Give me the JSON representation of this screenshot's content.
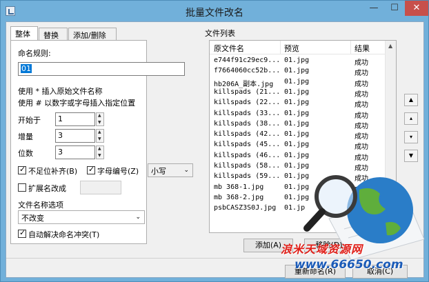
{
  "window": {
    "title": "批量文件改名",
    "minimize_glyph": "—",
    "maximize_glyph": "☐",
    "close_glyph": "✕"
  },
  "tabs": [
    {
      "label": "整体"
    },
    {
      "label": "替换"
    },
    {
      "label": "添加/删除"
    }
  ],
  "rules": {
    "label": "命名规则:",
    "value": "01",
    "hint1": "使用 * 插入原始文件名称",
    "hint2": "使用 # 以数字或字母插入指定位置",
    "start_label": "开始于",
    "start_value": "1",
    "step_label": "增量",
    "step_value": "3",
    "digits_label": "位数",
    "digits_value": "3",
    "pad_label": "不足位补齐(B)",
    "letter_label": "字母编号(Z)",
    "case_value": "小写",
    "ext_label": "扩展名改成",
    "options_label": "文件名称选项",
    "options_value": "不改变",
    "conflict_label": "自动解决命名冲突(T)"
  },
  "filelist": {
    "title": "文件列表",
    "headers": [
      "原文件名",
      "预览",
      "结果"
    ],
    "rows": [
      {
        "name": "e744f91c29ec9...",
        "preview": "01.jpg",
        "result": "成功"
      },
      {
        "name": "f7664060cc52b...",
        "preview": "01.jpg",
        "result": "成功"
      },
      {
        "name": "hb206A_副本.jpg",
        "preview": "01.jpg",
        "result": "成功"
      },
      {
        "name": "killspads (21...",
        "preview": "01.jpg",
        "result": "成功"
      },
      {
        "name": "killspads (22...",
        "preview": "01.jpg",
        "result": "成功"
      },
      {
        "name": "killspads (33...",
        "preview": "01.jpg",
        "result": "成功"
      },
      {
        "name": "killspads (38...",
        "preview": "01.jpg",
        "result": "成功"
      },
      {
        "name": "killspads (42...",
        "preview": "01.jpg",
        "result": "成功"
      },
      {
        "name": "killspads (45...",
        "preview": "01.jpg",
        "result": "成功"
      },
      {
        "name": "killspads (46...",
        "preview": "01.jpg",
        "result": "成功"
      },
      {
        "name": "killspads (58...",
        "preview": "01.jpg",
        "result": "成功"
      },
      {
        "name": "killspads (59...",
        "preview": "01.jpg",
        "result": "成功"
      },
      {
        "name": "mb 368-1.jpg",
        "preview": "01.jpg",
        "result": "成功"
      },
      {
        "name": "mb 368-2.jpg",
        "preview": "01.jpg",
        "result": "成功"
      },
      {
        "name": "psbCASZ3S0J.jpg",
        "preview": "01.jp",
        "result": ""
      }
    ],
    "add_label": "添加(A)",
    "remove_label": "移除(D)"
  },
  "footer": {
    "rename_label": "重新命名(R)",
    "cancel_label": "取消(C)"
  },
  "watermark": {
    "line1": "浪米天域资源网",
    "line2": "www.66650.com"
  },
  "colors": {
    "titlebar": "#71b0da",
    "close": "#c7504b",
    "selection": "#0078d7",
    "watermark_red": "#e0201a",
    "watermark_blue": "#1b5bb8"
  }
}
